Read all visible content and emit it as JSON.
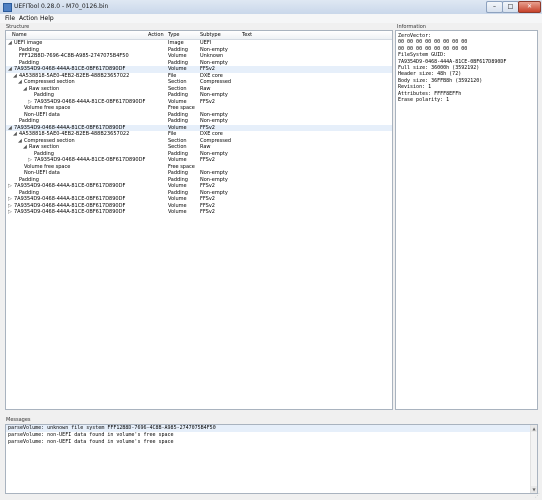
{
  "window": {
    "title": "UEFITool 0.28.0 - M70_0126.bin",
    "min_glyph": "–",
    "max_glyph": "□",
    "close_glyph": "✕"
  },
  "menu": [
    "File",
    "Action",
    "Help"
  ],
  "structure": {
    "label": "Structure",
    "columns": [
      "Name",
      "Action",
      "Type",
      "Subtype",
      "Text"
    ],
    "rows": [
      {
        "indent": 0,
        "toggle": "◢",
        "name": "UEFI image",
        "action": "",
        "type": "Image",
        "subtype": "UEFI",
        "text": "",
        "selected": false
      },
      {
        "indent": 1,
        "toggle": "",
        "name": "Padding",
        "action": "",
        "type": "Padding",
        "subtype": "Non-empty",
        "text": "",
        "selected": false
      },
      {
        "indent": 1,
        "toggle": "",
        "name": "FFF12B8D-7696-4C8B-A985-2747075B4F50",
        "action": "",
        "type": "Volume",
        "subtype": "Unknown",
        "text": "",
        "selected": false
      },
      {
        "indent": 1,
        "toggle": "",
        "name": "Padding",
        "action": "",
        "type": "Padding",
        "subtype": "Non-empty",
        "text": "",
        "selected": false
      },
      {
        "indent": 0,
        "toggle": "◢",
        "name": "7A9354D9-0468-444A-81CE-0BF617D890DF",
        "action": "",
        "type": "Volume",
        "subtype": "FFSv2",
        "text": "",
        "selected": true
      },
      {
        "indent": 1,
        "toggle": "◢",
        "name": "4A538818-5AE0-4EB2-B2EB-488B23657022",
        "action": "",
        "type": "File",
        "subtype": "DXE core",
        "text": "",
        "selected": false
      },
      {
        "indent": 2,
        "toggle": "◢",
        "name": "Compressed section",
        "action": "",
        "type": "Section",
        "subtype": "Compressed",
        "text": "",
        "selected": false
      },
      {
        "indent": 3,
        "toggle": "◢",
        "name": "Raw section",
        "action": "",
        "type": "Section",
        "subtype": "Raw",
        "text": "",
        "selected": false
      },
      {
        "indent": 4,
        "toggle": "",
        "name": "Padding",
        "action": "",
        "type": "Padding",
        "subtype": "Non-empty",
        "text": "",
        "selected": false
      },
      {
        "indent": 4,
        "toggle": "▷",
        "name": "7A9354D9-0468-444A-81CE-0BF617D890DF",
        "action": "",
        "type": "Volume",
        "subtype": "FFSv2",
        "text": "",
        "selected": false
      },
      {
        "indent": 2,
        "toggle": "",
        "name": "Volume free space",
        "action": "",
        "type": "Free space",
        "subtype": "",
        "text": "",
        "selected": false
      },
      {
        "indent": 2,
        "toggle": "",
        "name": "Non-UEFI data",
        "action": "",
        "type": "Padding",
        "subtype": "Non-empty",
        "text": "",
        "selected": false
      },
      {
        "indent": 1,
        "toggle": "",
        "name": "Padding",
        "action": "",
        "type": "Padding",
        "subtype": "Non-empty",
        "text": "",
        "selected": false
      },
      {
        "indent": 0,
        "toggle": "◢",
        "name": "7A9354D9-0468-444A-81CE-0BF617D890DF",
        "action": "",
        "type": "Volume",
        "subtype": "FFSv2",
        "text": "",
        "selected": true
      },
      {
        "indent": 1,
        "toggle": "◢",
        "name": "4A538818-5AE0-4EB2-B2EB-488B23657022",
        "action": "",
        "type": "File",
        "subtype": "DXE core",
        "text": "",
        "selected": false
      },
      {
        "indent": 2,
        "toggle": "◢",
        "name": "Compressed section",
        "action": "",
        "type": "Section",
        "subtype": "Compressed",
        "text": "",
        "selected": false
      },
      {
        "indent": 3,
        "toggle": "◢",
        "name": "Raw section",
        "action": "",
        "type": "Section",
        "subtype": "Raw",
        "text": "",
        "selected": false
      },
      {
        "indent": 4,
        "toggle": "",
        "name": "Padding",
        "action": "",
        "type": "Padding",
        "subtype": "Non-empty",
        "text": "",
        "selected": false
      },
      {
        "indent": 4,
        "toggle": "▷",
        "name": "7A9354D9-0468-444A-81CE-0BF617D890DF",
        "action": "",
        "type": "Volume",
        "subtype": "FFSv2",
        "text": "",
        "selected": false
      },
      {
        "indent": 2,
        "toggle": "",
        "name": "Volume free space",
        "action": "",
        "type": "Free space",
        "subtype": "",
        "text": "",
        "selected": false
      },
      {
        "indent": 2,
        "toggle": "",
        "name": "Non-UEFI data",
        "action": "",
        "type": "Padding",
        "subtype": "Non-empty",
        "text": "",
        "selected": false
      },
      {
        "indent": 1,
        "toggle": "",
        "name": "Padding",
        "action": "",
        "type": "Padding",
        "subtype": "Non-empty",
        "text": "",
        "selected": false
      },
      {
        "indent": 0,
        "toggle": "▷",
        "name": "7A9354D9-0468-444A-81CE-0BF617D890DF",
        "action": "",
        "type": "Volume",
        "subtype": "FFSv2",
        "text": "",
        "selected": false
      },
      {
        "indent": 1,
        "toggle": "",
        "name": "Padding",
        "action": "",
        "type": "Padding",
        "subtype": "Non-empty",
        "text": "",
        "selected": false
      },
      {
        "indent": 0,
        "toggle": "▷",
        "name": "7A9354D9-0468-444A-81CE-0BF617D890DF",
        "action": "",
        "type": "Volume",
        "subtype": "FFSv2",
        "text": "",
        "selected": false
      },
      {
        "indent": 0,
        "toggle": "▷",
        "name": "7A9354D9-0468-444A-81CE-0BF617D890DF",
        "action": "",
        "type": "Volume",
        "subtype": "FFSv2",
        "text": "",
        "selected": false
      },
      {
        "indent": 0,
        "toggle": "▷",
        "name": "7A9354D9-0468-444A-81CE-0BF617D890DF",
        "action": "",
        "type": "Volume",
        "subtype": "FFSv2",
        "text": "",
        "selected": false
      }
    ]
  },
  "information": {
    "label": "Information",
    "lines": [
      "ZeroVector:",
      "00 00 00 00 00 00 00 00",
      "00 00 00 00 00 00 00 00",
      "FileSystem GUID:",
      "7A9354D9-0468-444A-81CE-0BF617D890DF",
      "Full size: 36000h (3592192)",
      "Header size: 48h (72)",
      "Body size: 36FFB8h (3592120)",
      "Revision: 1",
      "Attributes: FFFF8EFFh",
      "Erase polarity: 1"
    ]
  },
  "messages": {
    "label": "Messages",
    "lines": [
      {
        "text": "parseVolume: unknown file system FFF12B8D-7696-4C8B-A985-2747075B4F50",
        "selected": true
      },
      {
        "text": "parseVolume: non-UEFI data found in volume's free space",
        "selected": false
      },
      {
        "text": "parseVolume: non-UEFI data found in volume's free space",
        "selected": false
      }
    ]
  },
  "icons": {
    "app": "uefitool-icon",
    "scroll_up": "▲",
    "scroll_down": "▼",
    "grip": "⋰"
  }
}
